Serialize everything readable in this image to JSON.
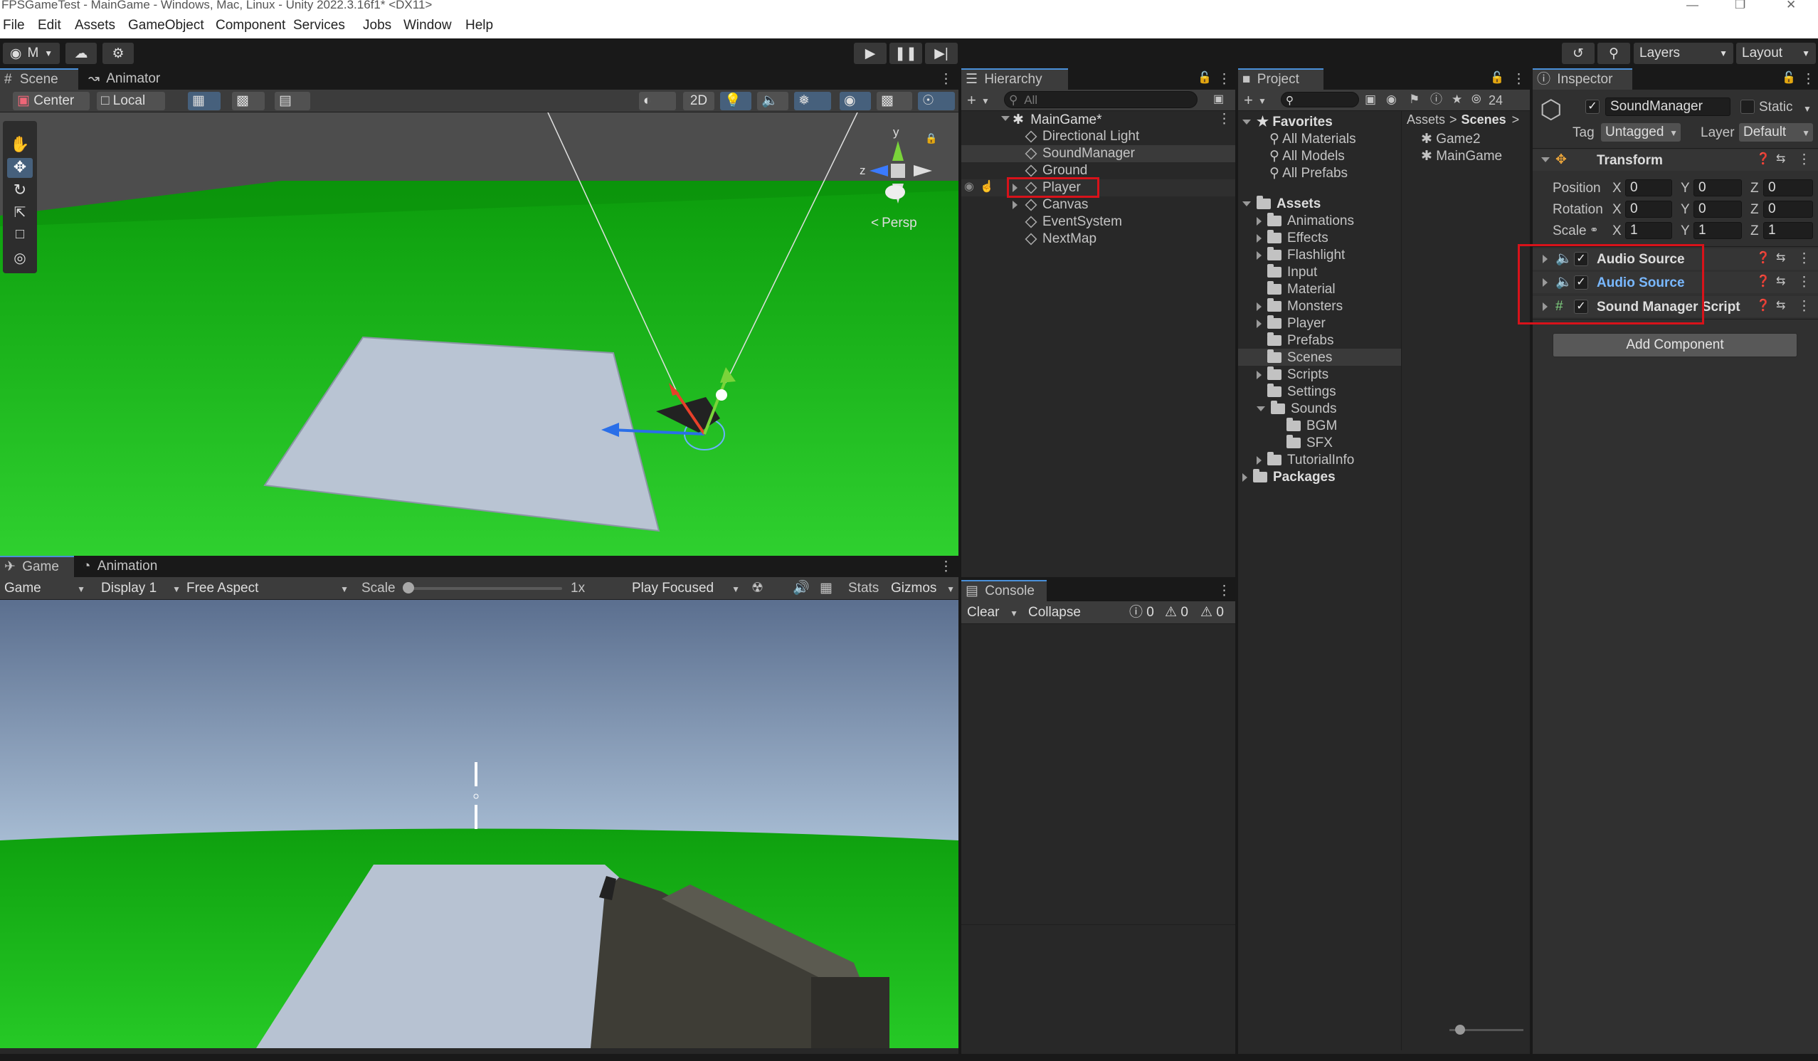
{
  "window": {
    "title": "FPSGameTest - MainGame - Windows, Mac, Linux - Unity 2022.3.16f1* <DX11>"
  },
  "menu": [
    "File",
    "Edit",
    "Assets",
    "GameObject",
    "Component",
    "Services",
    "Jobs",
    "Window",
    "Help"
  ],
  "toolbar": {
    "account": "M",
    "layers": "Layers",
    "layout": "Layout"
  },
  "scene": {
    "tabs": [
      "Scene",
      "Animator"
    ],
    "pivot": "Center",
    "space": "Local",
    "mode2d": "2D",
    "persp": "Persp",
    "gizmo_axes": {
      "y": "y",
      "z": "z"
    }
  },
  "game": {
    "tabs": [
      "Game",
      "Animation"
    ],
    "view": "Game",
    "display": "Display 1",
    "aspect": "Free Aspect",
    "scale_label": "Scale",
    "scale_value": "1x",
    "play_mode": "Play Focused",
    "stats": "Stats",
    "gizmos": "Gizmos"
  },
  "hierarchy": {
    "title": "Hierarchy",
    "search_placeholder": "All",
    "scene": "MainGame*",
    "items": [
      "Directional Light",
      "SoundManager",
      "Ground",
      "Player",
      "Canvas",
      "EventSystem",
      "NextMap"
    ]
  },
  "console": {
    "title": "Console",
    "clear": "Clear",
    "collapse": "Collapse",
    "log_count": "0",
    "warn_count": "0",
    "error_count": "0"
  },
  "project": {
    "title": "Project",
    "hidden_count": "24",
    "favorites_label": "Favorites",
    "favorites": [
      "All Materials",
      "All Models",
      "All Prefabs"
    ],
    "assets_label": "Assets",
    "folders": [
      "Animations",
      "Effects",
      "Flashlight",
      "Input",
      "Material",
      "Monsters",
      "Player",
      "Prefabs",
      "Scenes",
      "Scripts",
      "Settings",
      "Sounds",
      "BGM",
      "SFX",
      "TutorialInfo"
    ],
    "packages_label": "Packages",
    "breadcrumb": [
      "Assets",
      "Scenes"
    ],
    "files": [
      "Game2",
      "MainGame"
    ]
  },
  "inspector": {
    "title": "Inspector",
    "object_name": "SoundManager",
    "static_label": "Static",
    "tag_label": "Tag",
    "tag_value": "Untagged",
    "layer_label": "Layer",
    "layer_value": "Default",
    "transform_label": "Transform",
    "position_label": "Position",
    "rotation_label": "Rotation",
    "scale_label": "Scale",
    "axis": {
      "x": "X",
      "y": "Y",
      "z": "Z"
    },
    "position": [
      "0",
      "0",
      "0"
    ],
    "rotation": [
      "0",
      "0",
      "0"
    ],
    "scale": [
      "1",
      "1",
      "1"
    ],
    "components": [
      "Audio Source",
      "Audio Source",
      "Sound Manager Script"
    ],
    "add_component": "Add Component"
  },
  "colors": {
    "accent": "#4a90d9",
    "highlight": "#d8121a",
    "ground": "#1fb51f",
    "selected_component": "#79b8ff"
  }
}
